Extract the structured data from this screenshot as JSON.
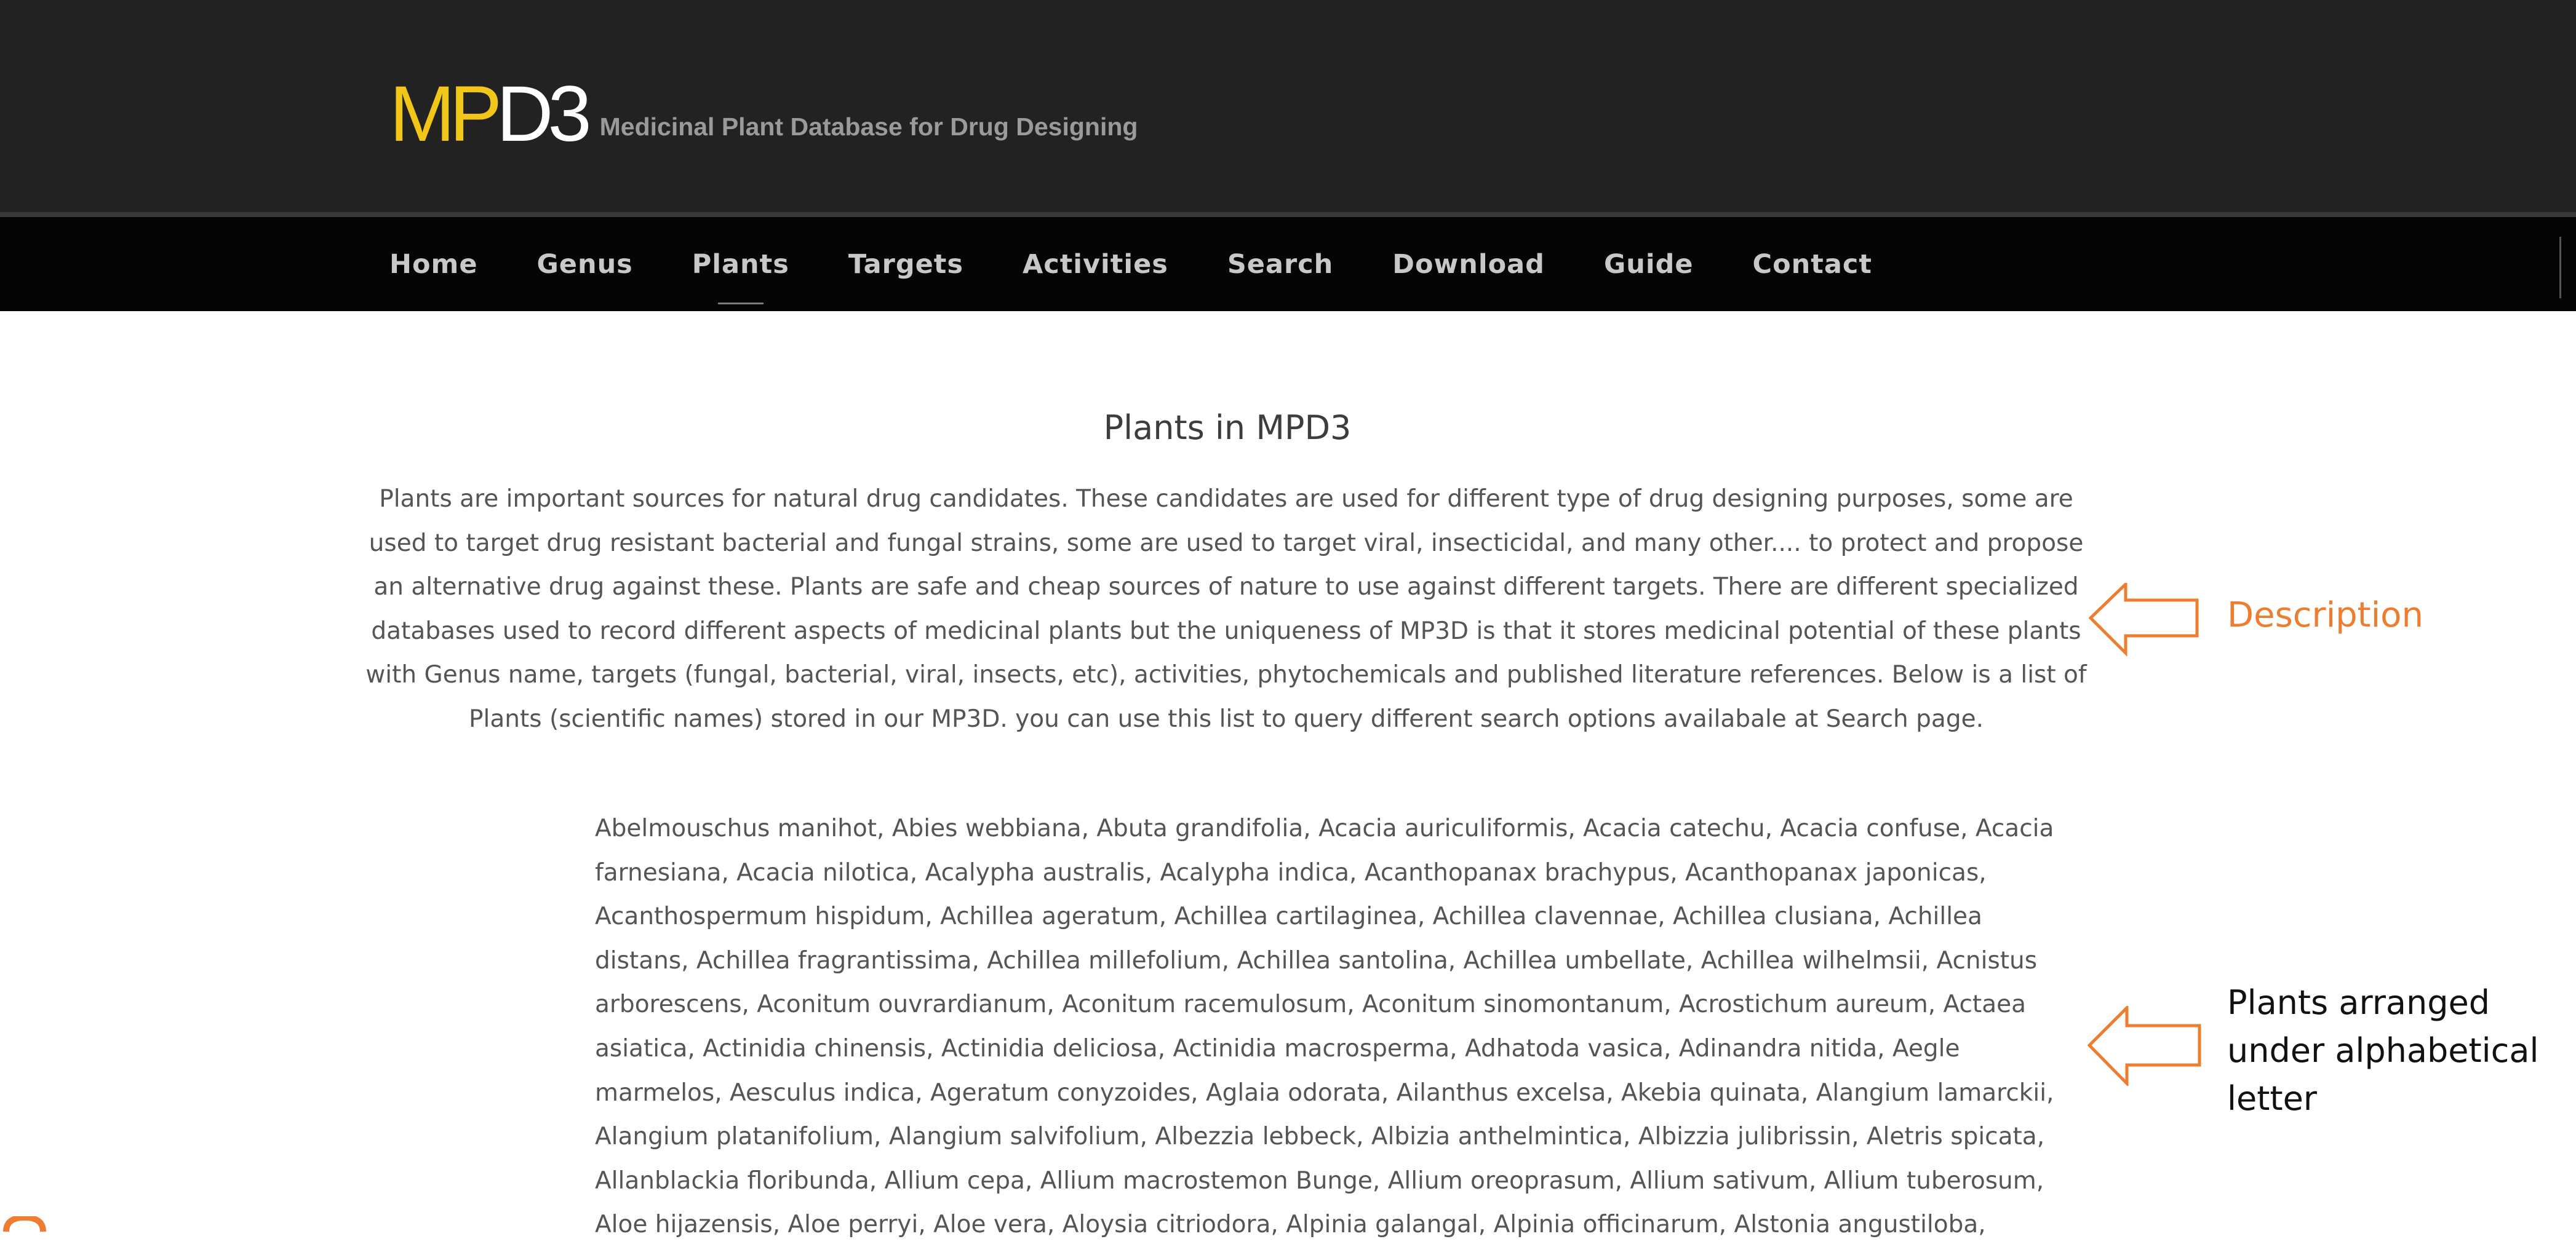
{
  "header": {
    "logo": {
      "mp": "MP",
      "d3": "D3"
    },
    "tagline": "Medicinal Plant Database for Drug Designing"
  },
  "nav": {
    "items": [
      {
        "label": "Home"
      },
      {
        "label": "Genus"
      },
      {
        "label": "Plants",
        "active": true
      },
      {
        "label": "Targets"
      },
      {
        "label": "Activities"
      },
      {
        "label": "Search"
      },
      {
        "label": "Download"
      },
      {
        "label": "Guide"
      },
      {
        "label": "Contact"
      }
    ]
  },
  "main": {
    "title": "Plants in MPD3",
    "description": "Plants are important sources for natural drug candidates. These candidates are used for different type of drug designing purposes, some are used to target drug resistant bacterial and fungal strains, some are used to target viral, insecticidal, and many other.... to protect and propose an alternative drug against these. Plants are safe and cheap sources of nature to use against different targets. There are different specialized databases used to record different aspects of medicinal plants but the uniqueness of MP3D is that it stores medicinal potential of these plants with Genus name, targets (fungal, bacterial, viral, insects, etc), activities, phytochemicals and published literature references. Below is a list of Plants (scientific names) stored in our MP3D. you can use this list to query different search options availabale at Search page.",
    "plant_list": "Abelmouschus manihot, Abies webbiana, Abuta grandifolia, Acacia auriculiformis, Acacia catechu, Acacia confuse, Acacia farnesiana, Acacia nilotica, Acalypha australis, Acalypha indica, Acanthopanax brachypus, Acanthopanax japonicas, Acanthospermum hispidum, Achillea ageratum, Achillea cartilaginea, Achillea clavennae, Achillea clusiana, Achillea distans, Achillea fragrantissima, Achillea millefolium, Achillea santolina, Achillea umbellate, Achillea wilhelmsii, Acnistus arborescens, Aconitum ouvrardianum, Aconitum racemulosum, Aconitum sinomontanum, Acrostichum aureum, Actaea asiatica, Actinidia chinensis, Actinidia deliciosa, Actinidia macrosperma, Adhatoda vasica, Adinandra nitida, Aegle marmelos, Aesculus indica, Ageratum conyzoides, Aglaia odorata, Ailanthus excelsa, Akebia quinata, Alangium lamarckii, Alangium platanifolium, Alangium salvifolium, Albezzia lebbeck, Albizia anthelmintica, Albizzia julibrissin, Aletris spicata, Allanblackia floribunda, Allium cepa, Allium macrostemon Bunge, Allium oreoprasum, Allium sativum, Allium tuberosum, Aloe hijazensis, Aloe perryi, Aloe vera, Aloysia citriodora, Alpinia galangal, Alpinia officinarum, Alstonia angustiloba,"
  },
  "annotations": {
    "description_label": "Description",
    "plants_label": "Plants arranged under alphabetical letter",
    "color": "#ed7d31"
  },
  "colors": {
    "header_bg": "#222222",
    "nav_bg": "#050505",
    "logo_accent": "#f2c618"
  }
}
